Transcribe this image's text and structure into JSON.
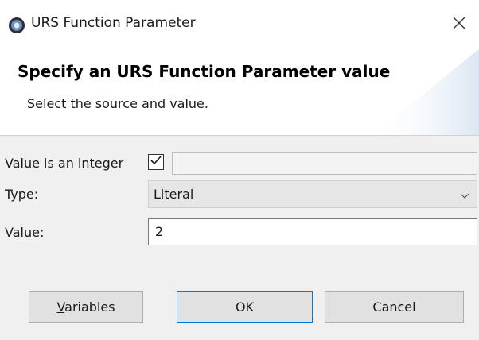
{
  "window": {
    "title": "URS Function Parameter"
  },
  "banner": {
    "heading": "Specify an URS Function Parameter value",
    "description": "Select the source and value."
  },
  "form": {
    "integer_label": "Value is an integer",
    "integer_checked": true,
    "type_label": "Type:",
    "type_value": "Literal",
    "value_label": "Value:",
    "value_value": "2"
  },
  "buttons": {
    "variables": "Variables",
    "ok": "OK",
    "cancel": "Cancel"
  },
  "icons": {
    "app": "app-icon",
    "close": "close-icon",
    "check": "check-icon",
    "dropdown": "chevron-down-icon"
  }
}
